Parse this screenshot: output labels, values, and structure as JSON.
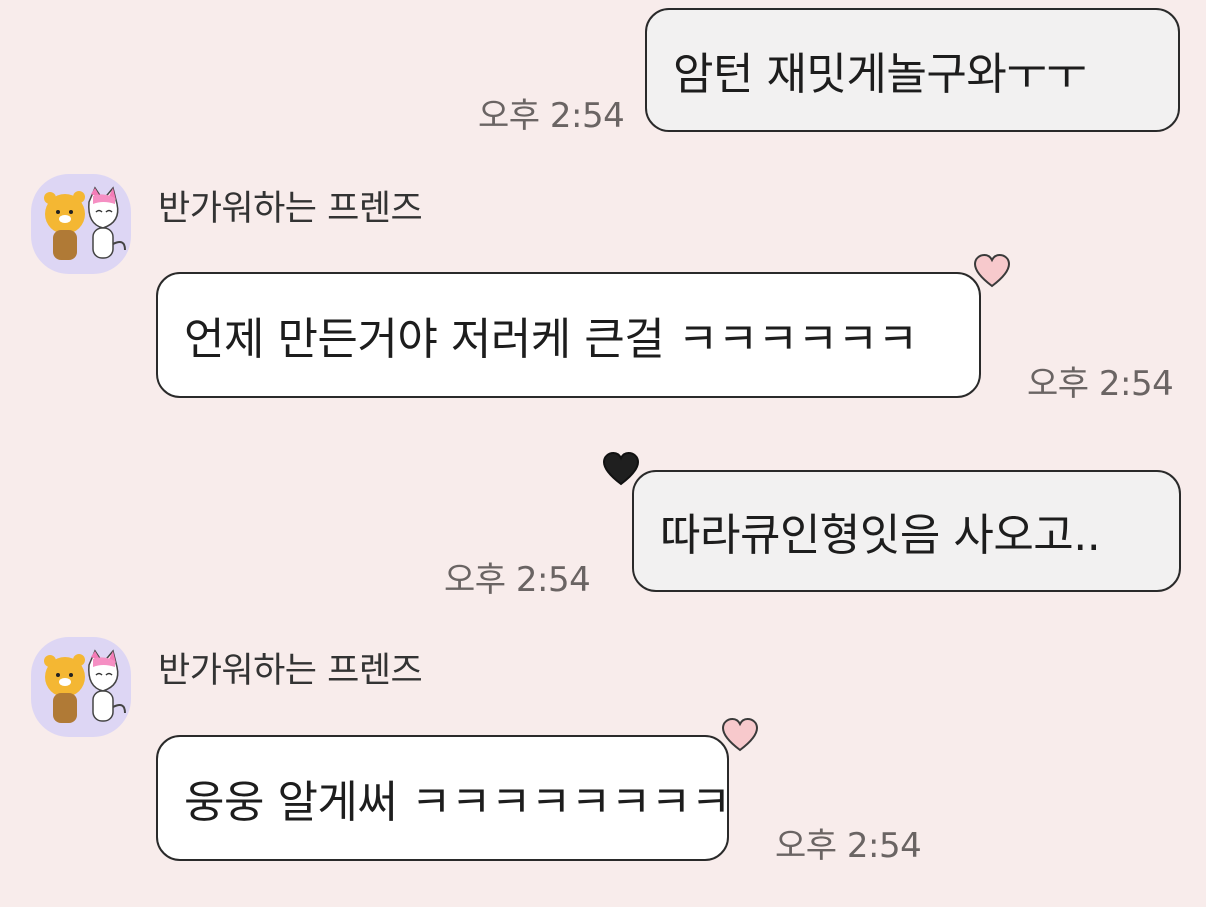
{
  "messages": [
    {
      "direction": "outgoing",
      "text": "암턴 재밋게놀구와ㅜㅜ",
      "time": "오후 2:54"
    },
    {
      "direction": "incoming",
      "sender": "반가워하는 프렌즈",
      "text": "언제 만든거야 저러케 큰걸 ㅋㅋㅋㅋㅋㅋ",
      "time": "오후 2:54",
      "reaction": "pink-heart-icon"
    },
    {
      "direction": "outgoing",
      "text": "따라큐인형잇음 사오고..",
      "time": "오후 2:54",
      "reaction": "black-heart-icon"
    },
    {
      "direction": "incoming",
      "sender": "반가워하는 프렌즈",
      "text": "웅웅 알게써 ㅋㅋㅋㅋㅋㅋㅋㅋ",
      "time": "오후 2:54",
      "reaction": "pink-heart-icon"
    }
  ],
  "colors": {
    "background": "#f8eceb",
    "outgoing_bubble": "#f2f1f1",
    "incoming_bubble": "#ffffff",
    "bubble_border": "#2a2a2a",
    "time_text": "#6a6463",
    "avatar_bg": "#ddd6f4",
    "pink_heart": "#f7c9cc",
    "black_heart": "#1f1f1f"
  }
}
